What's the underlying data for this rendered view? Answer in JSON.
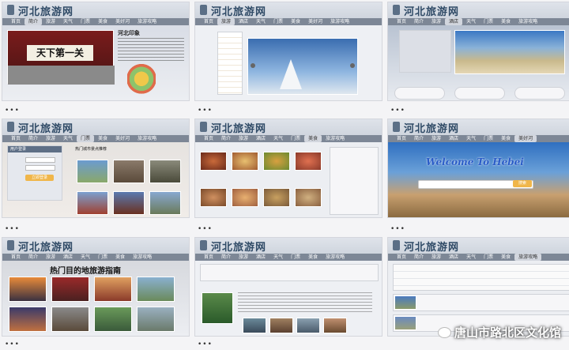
{
  "site_title": "河北旅游网",
  "nav": [
    "首页",
    "简介",
    "旅游",
    "酒店",
    "天气",
    "门票",
    "美食",
    "美好河",
    "旅游攻略"
  ],
  "panel1": {
    "banner_text": "天下第一关",
    "section_title": "河北印象"
  },
  "panel5": {
    "section_title": "热门城市景点推荐",
    "login_title": "用户登录",
    "login_btn": "立即登录"
  },
  "panel6": {
    "welcome": "Welcome To Hebei",
    "search_btn": "搜索"
  },
  "panel7": {
    "heading": "热门目的地旅游指南"
  },
  "watermark": "唐山市路北区文化馆",
  "more_dots": "•••"
}
